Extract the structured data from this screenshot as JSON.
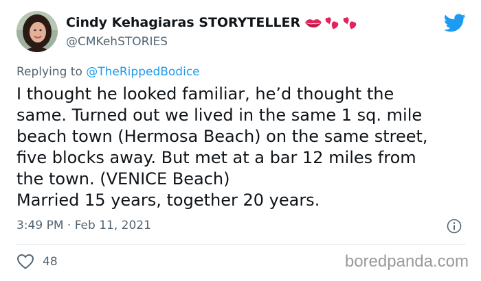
{
  "tweet": {
    "author": {
      "display_name": "Cindy Kehagiaras STORYTELLER",
      "handle": "@CMKehSTORIES",
      "name_emojis": [
        "kiss-mark-icon",
        "two-hearts-icon",
        "two-hearts-icon"
      ],
      "avatar": "avatar-photo"
    },
    "reply_prefix": "Replying to",
    "reply_to": "@TheRippedBodice",
    "text_lines": [
      "I thought he looked familiar, he’d thought the",
      "same. Turned out we lived in the same 1 sq. mile",
      "beach town (Hermosa Beach) on the same street,",
      "five blocks away. But met at a bar 12 miles from",
      "the town. (VENICE Beach)",
      "Married 15 years, together 20 years."
    ],
    "timestamp": "3:49 PM · Feb 11, 2021",
    "like_count": "48"
  },
  "watermark": "boredpanda.com",
  "colors": {
    "twitter_blue": "#1d9bf0",
    "secondary_text": "#536471",
    "primary_text": "#0f1419",
    "heart_red": "#e0245e"
  }
}
